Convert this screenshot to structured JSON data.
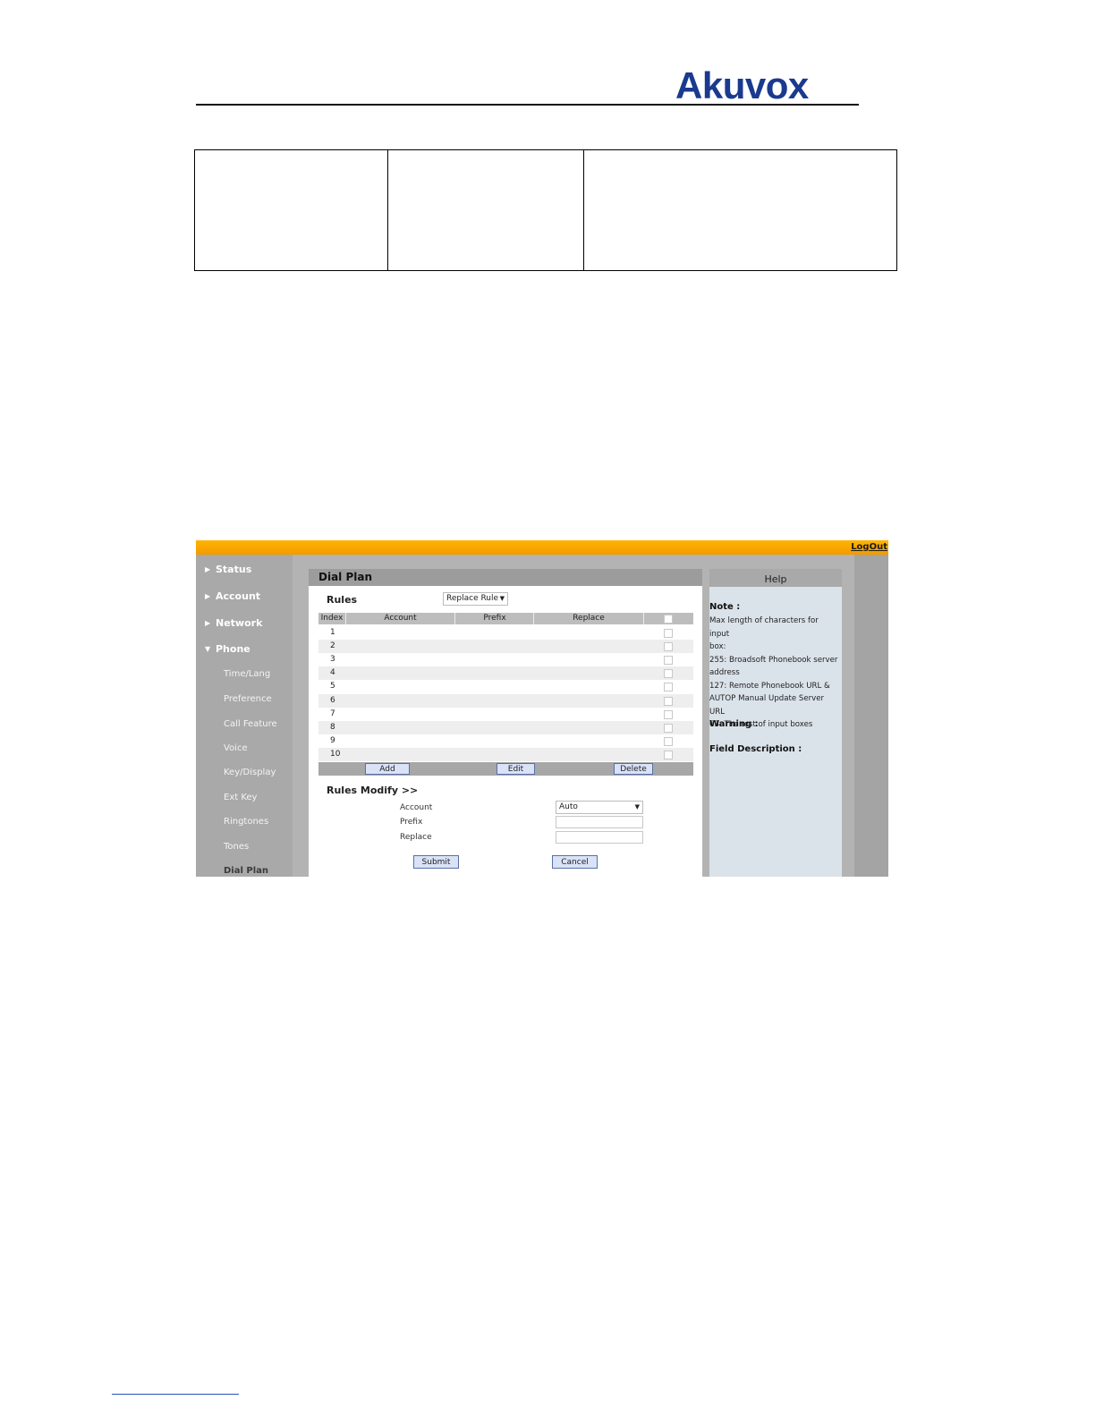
{
  "brand": {
    "logo_text": "Akuvox",
    "color": "#1a3a8f"
  },
  "ui": {
    "logout": "LogOut",
    "sidebar": {
      "main_items": [
        {
          "label": "Status",
          "expanded": false
        },
        {
          "label": "Account",
          "expanded": false
        },
        {
          "label": "Network",
          "expanded": false
        },
        {
          "label": "Phone",
          "expanded": true
        }
      ],
      "sub_items": [
        "Time/Lang",
        "Preference",
        "Call Feature",
        "Voice",
        "Key/Display",
        "Ext Key",
        "Ringtones",
        "Tones",
        "Dial Plan"
      ],
      "active": "Dial Plan"
    },
    "main": {
      "title": "Dial Plan",
      "rules_label": "Rules",
      "rule_type": "Replace Rule",
      "columns": [
        "Index",
        "Account",
        "Prefix",
        "Replace"
      ],
      "rows": [
        "1",
        "2",
        "3",
        "4",
        "5",
        "6",
        "7",
        "8",
        "9",
        "10"
      ],
      "buttons": {
        "add": "Add",
        "edit": "Edit",
        "delete": "Delete"
      },
      "modify_label": "Rules Modify >>",
      "form": {
        "account_label": "Account",
        "account_value": "Auto",
        "prefix_label": "Prefix",
        "replace_label": "Replace"
      },
      "submit": "Submit",
      "cancel": "Cancel"
    },
    "help": {
      "title": "Help",
      "note_label": "Note :",
      "note_lines": [
        "Max length of characters for input",
        "box:",
        "255: Broadsoft Phonebook server",
        "address",
        "127: Remote Phonebook URL &",
        "AUTOP Manual Update Server URL",
        "63: The rest of input boxes"
      ],
      "warning_label": "Warning :",
      "field_desc_label": "Field Description :"
    },
    "colors": {
      "topbar": "#f29a00",
      "sidebar": "#a9a9a9",
      "button_fill": "#d9e2f7"
    }
  }
}
